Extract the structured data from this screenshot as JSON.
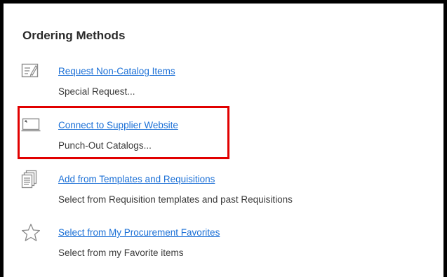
{
  "panel": {
    "title": "Ordering Methods"
  },
  "items": [
    {
      "icon": "form-edit-icon",
      "link": "Request Non-Catalog Items",
      "description": "Special Request..."
    },
    {
      "icon": "laptop-screen-icon",
      "link": "Connect to Supplier Website",
      "description": "Punch-Out Catalogs..."
    },
    {
      "icon": "documents-stack-icon",
      "link": "Add from Templates and Requisitions",
      "description": "Select from Requisition templates and past Requisitions"
    },
    {
      "icon": "star-icon",
      "link": "Select from My Procurement Favorites",
      "description": "Select from my Favorite items"
    }
  ],
  "colors": {
    "link": "#1a6fd6",
    "highlight": "#e10000",
    "text": "#3a3a3a",
    "icon": "#8a8a8a"
  }
}
